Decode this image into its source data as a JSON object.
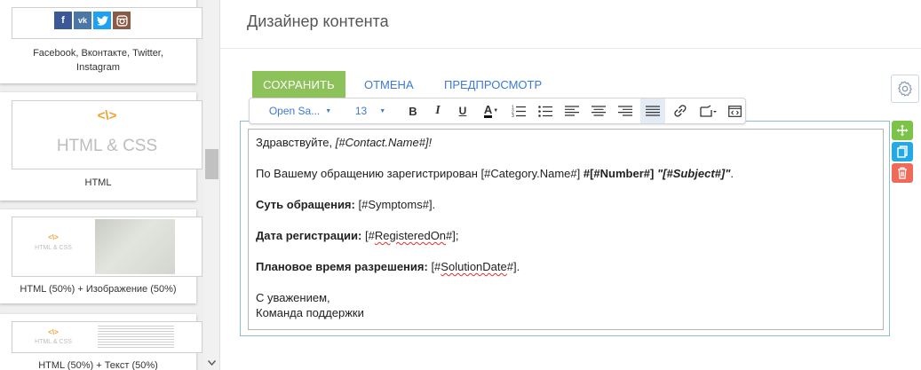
{
  "palette": {
    "blocks": [
      {
        "caption_line1": "Facebook, Вконтакте, Twitter,",
        "caption_line2": "Instagram",
        "icons": [
          "f",
          "vk",
          "t",
          "ig"
        ]
      },
      {
        "caption": "HTML",
        "thumb_icon": "<\\>",
        "thumb_title": "HTML & CSS"
      },
      {
        "caption": "HTML (50%) + Изображение (50%)",
        "thumb_icon": "<\\>",
        "thumb_title": "HTML & CSS"
      },
      {
        "caption": "HTML (50%) + Текст (50%)",
        "thumb_icon": "<\\>",
        "thumb_title": "HTML & CSS"
      }
    ]
  },
  "header": {
    "title": "Дизайнер контента"
  },
  "actions": {
    "save": "СОХРАНИТЬ",
    "cancel": "ОТМЕНА",
    "preview": "ПРЕДПРОСМОТР"
  },
  "toolbar": {
    "font_family": "Open Sa...",
    "font_size": "13"
  },
  "content": {
    "greeting": "Здравствуйте, ",
    "greeting_macro": "[#Contact.Name#]!",
    "registered_prefix": "По Вашему обращению зарегистрирован [#Category.Name#] ",
    "number_macro": "#[#Number#]",
    "subject_macro": "\"[#Subject#]\"",
    "period": ".",
    "symptoms_label": "Суть обращения:",
    "symptoms_value": " [#Symptoms#].",
    "reg_label": "Дата регистрации:",
    "reg_value_pre": " [#",
    "reg_value_word": "RegisteredOn",
    "reg_value_post": "#];",
    "solution_label": "Плановое время разрешения:",
    "solution_value_pre": " [#",
    "solution_value_word": "SolutionDate",
    "solution_value_post": "#].",
    "regards": "С уважением,",
    "team": "Команда поддержки"
  },
  "colors": {
    "save_button": "#8dc25b",
    "link_blue": "#3a7bd5",
    "frame_border": "#8cc2cf",
    "move_tool": "#7cc34a",
    "copy_tool": "#24a9e1",
    "delete_tool": "#f06a5a",
    "code_icon": "#f0a030"
  }
}
